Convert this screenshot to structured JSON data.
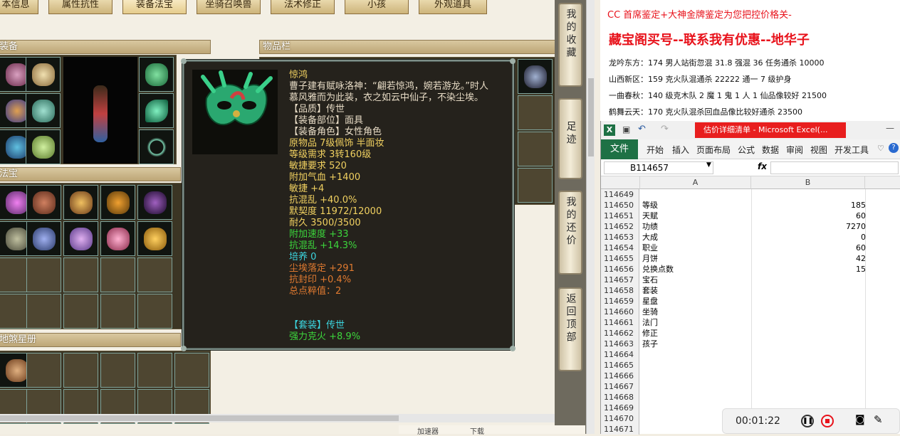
{
  "tabs": [
    "本信息",
    "属性抗性",
    "装备法宝",
    "坐骑召唤兽",
    "法术修正",
    "小孩",
    "外观道具"
  ],
  "sections": {
    "equipment": "装备",
    "inventory": "物品栏",
    "treasure": "法宝",
    "star_book": "地煞星册"
  },
  "tooltip": {
    "name": "惊鸿",
    "lines": [
      {
        "text": "曹子建有赋咏洛神：“翩若惊鸿，婉若游龙。”时人",
        "color": "#e8dcc6"
      },
      {
        "text": "慕风雅而为此装，衣之如云中仙子，不染尘埃。",
        "color": "#e8dcc6"
      },
      {
        "text": "【品质】传世",
        "color": "#e8dcc6"
      },
      {
        "text": "【装备部位】面具",
        "color": "#e8dcc6"
      },
      {
        "text": "【装备角色】女性角色",
        "color": "#e8dcc6"
      },
      {
        "text": "原物品 7级佩饰 半面妆",
        "color": "#f0d060"
      },
      {
        "text": "等级需求 3转160级",
        "color": "#f0d060"
      },
      {
        "text": "敏捷要求 520",
        "color": "#f0d060"
      },
      {
        "text": "附加气血 +1400",
        "color": "#f0d060"
      },
      {
        "text": "敏捷 +4",
        "color": "#f0d060"
      },
      {
        "text": "抗混乱 +40.0%",
        "color": "#f0d060"
      },
      {
        "text": "默契度 11972/12000",
        "color": "#f0d060"
      },
      {
        "text": "耐久 3500/3500",
        "color": "#f0d060"
      },
      {
        "text": "附加速度 +33",
        "color": "#3cd63c"
      },
      {
        "text": "抗混乱 +14.3%",
        "color": "#3cd63c"
      },
      {
        "text": "培养 0",
        "color": "#3cd6e0"
      },
      {
        "text": "尘埃落定 +291",
        "color": "#e07a30"
      },
      {
        "text": "抗封印 +0.4%",
        "color": "#e07a30"
      },
      {
        "text": "总点粹值：2",
        "color": "#e07a30"
      },
      {
        "text": " ",
        "color": "#e8dcc6"
      },
      {
        "text": " ",
        "color": "#e8dcc6"
      },
      {
        "text": "【套装】传世",
        "color": "#3cd6e0"
      },
      {
        "text": "强力克火 +8.9%",
        "color": "#3cd63c"
      }
    ]
  },
  "side_buttons": [
    {
      "label": "我的收藏"
    },
    {
      "label": "足迹"
    },
    {
      "label": "我的还价"
    },
    {
      "label": "返回顶部"
    }
  ],
  "notes": {
    "line1": "CC 首席鉴定+大神金牌鉴定为您把控价格关-",
    "title": "藏宝阁买号--联系我有优惠--地华子",
    "items": [
      "龙吟东方：174 男人站街忽混 31.8 强混 36 任务通杀 10000",
      "山西新区：159 克火队混通杀 22222 通一 7 级护身",
      "一曲春秋：140 级克木队 2 魔 1 鬼 1 人 1 仙品像较好 21500",
      "鹤舞云天：170 克火队混杀回血品像比较好通杀 23500"
    ]
  },
  "excel": {
    "window_title": "估价详细清单 - Microsoft Excel(...",
    "file_tab": "文件",
    "ribbon_tabs": [
      "开始",
      "插入",
      "页面布局",
      "公式",
      "数据",
      "审阅",
      "视图",
      "开发工具"
    ],
    "name_box": "B114657",
    "fx": "fx",
    "col_a": "A",
    "col_b": "B",
    "rows": [
      {
        "n": "114649",
        "a": "",
        "b": ""
      },
      {
        "n": "114650",
        "a": "等级",
        "b": "185"
      },
      {
        "n": "114651",
        "a": "天赋",
        "b": "60"
      },
      {
        "n": "114652",
        "a": "功绩",
        "b": "7270"
      },
      {
        "n": "114653",
        "a": "大成",
        "b": "0"
      },
      {
        "n": "114654",
        "a": "职业",
        "b": "60"
      },
      {
        "n": "114655",
        "a": "月饼",
        "b": "42"
      },
      {
        "n": "114656",
        "a": "兑换点数",
        "b": "15"
      },
      {
        "n": "114657",
        "a": "宝石",
        "b": ""
      },
      {
        "n": "114658",
        "a": "套装",
        "b": ""
      },
      {
        "n": "114659",
        "a": "星盘",
        "b": ""
      },
      {
        "n": "114660",
        "a": "坐骑",
        "b": ""
      },
      {
        "n": "114661",
        "a": "法门",
        "b": ""
      },
      {
        "n": "114662",
        "a": "修正",
        "b": ""
      },
      {
        "n": "114663",
        "a": "孩子",
        "b": ""
      },
      {
        "n": "114664",
        "a": "",
        "b": ""
      },
      {
        "n": "114665",
        "a": "",
        "b": ""
      },
      {
        "n": "114666",
        "a": "",
        "b": ""
      },
      {
        "n": "114667",
        "a": "",
        "b": ""
      },
      {
        "n": "114668",
        "a": "",
        "b": ""
      },
      {
        "n": "114669",
        "a": "",
        "b": ""
      },
      {
        "n": "114670",
        "a": "",
        "b": ""
      },
      {
        "n": "114671",
        "a": "",
        "b": ""
      }
    ]
  },
  "recorder": {
    "time": "00:01:22"
  },
  "status": {
    "speed": "加速器",
    "download": "下载"
  },
  "colors": {
    "accent_red": "#e8121b",
    "excel_green": "#1e7145",
    "tooltip_bg": "#25221c"
  }
}
